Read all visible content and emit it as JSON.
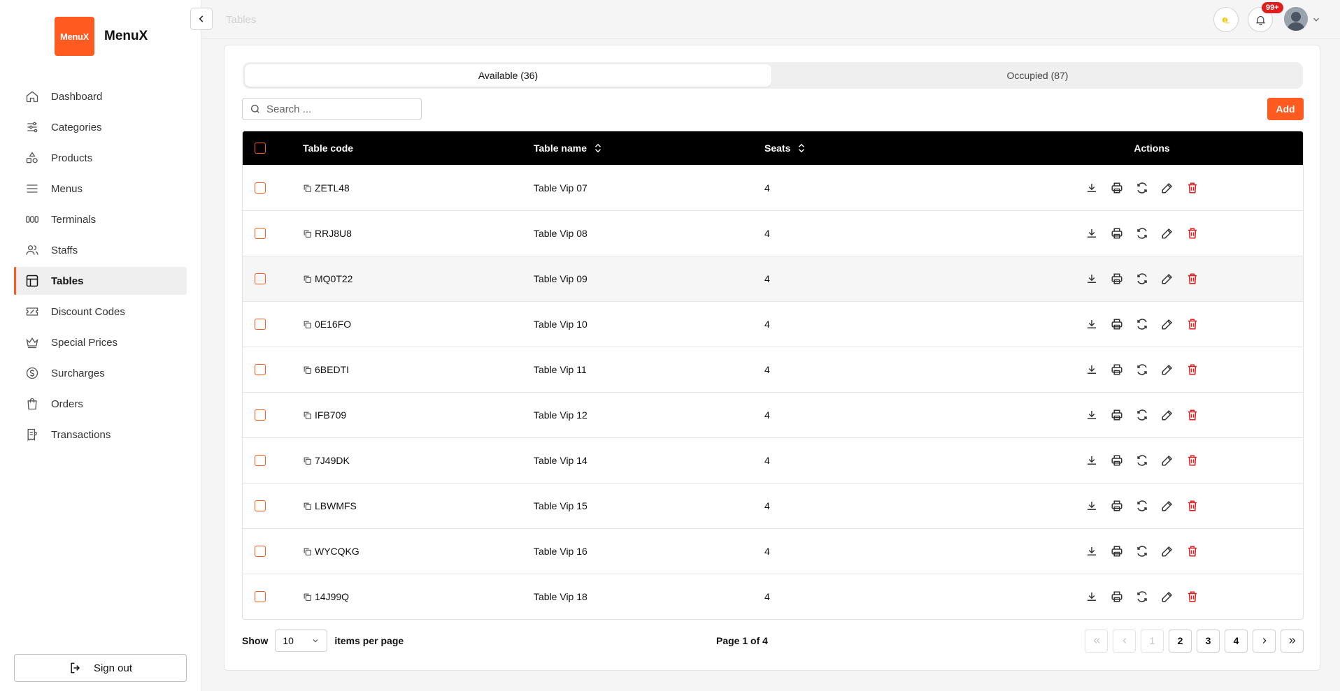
{
  "brand": {
    "logo_text": "MenuX",
    "name": "MenuX",
    "accent": "#ff5a1f"
  },
  "sidebar": {
    "items": [
      {
        "label": "Dashboard",
        "icon": "home-icon"
      },
      {
        "label": "Categories",
        "icon": "sliders-icon"
      },
      {
        "label": "Products",
        "icon": "shapes-icon"
      },
      {
        "label": "Menus",
        "icon": "menu-icon"
      },
      {
        "label": "Terminals",
        "icon": "terminal-icon"
      },
      {
        "label": "Staffs",
        "icon": "users-icon"
      },
      {
        "label": "Tables",
        "icon": "table-icon",
        "active": true
      },
      {
        "label": "Discount Codes",
        "icon": "ticket-icon"
      },
      {
        "label": "Special Prices",
        "icon": "crown-icon"
      },
      {
        "label": "Surcharges",
        "icon": "dollar-circle-icon"
      },
      {
        "label": "Orders",
        "icon": "shopping-bag-icon"
      },
      {
        "label": "Transactions",
        "icon": "receipt-icon"
      }
    ],
    "signout_label": "Sign out"
  },
  "topbar": {
    "page_title": "Tables",
    "notification_count": "99+"
  },
  "tabs": {
    "available": "Available (36)",
    "occupied": "Occupied (87)"
  },
  "search": {
    "placeholder": "Search ...",
    "value": ""
  },
  "add_label": "Add",
  "table": {
    "columns": {
      "code": "Table code",
      "name": "Table name",
      "seats": "Seats",
      "actions": "Actions"
    },
    "rows": [
      {
        "code": "ZETL48",
        "name": "Table Vip 07",
        "seats": "4"
      },
      {
        "code": "RRJ8U8",
        "name": "Table Vip 08",
        "seats": "4"
      },
      {
        "code": "MQ0T22",
        "name": "Table Vip 09",
        "seats": "4"
      },
      {
        "code": "0E16FO",
        "name": "Table Vip 10",
        "seats": "4"
      },
      {
        "code": "6BEDTI",
        "name": "Table Vip 11",
        "seats": "4"
      },
      {
        "code": "IFB709",
        "name": "Table Vip 12",
        "seats": "4"
      },
      {
        "code": "7J49DK",
        "name": "Table Vip 14",
        "seats": "4"
      },
      {
        "code": "LBWMFS",
        "name": "Table Vip 15",
        "seats": "4"
      },
      {
        "code": "WYCQKG",
        "name": "Table Vip 16",
        "seats": "4"
      },
      {
        "code": "14J99Q",
        "name": "Table Vip 18",
        "seats": "4"
      }
    ]
  },
  "pagination": {
    "show_label": "Show",
    "per_page": "10",
    "items_label": "items per page",
    "page_info": "Page 1 of 4",
    "pages": [
      "1",
      "2",
      "3",
      "4"
    ]
  }
}
